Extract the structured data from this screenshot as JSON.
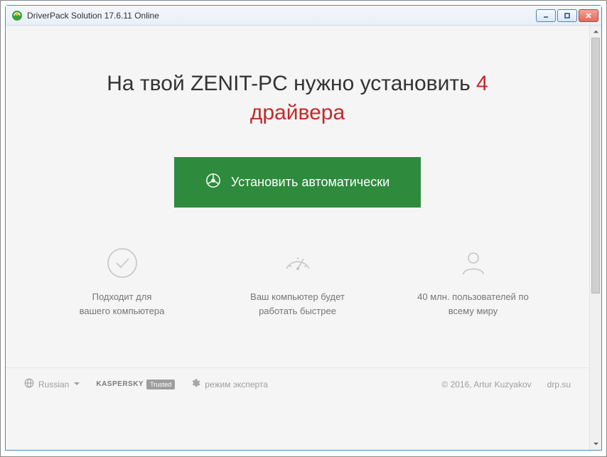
{
  "window": {
    "title": "DriverPack Solution 17.6.11 Online"
  },
  "headline": {
    "prefix": "На твой ",
    "pcname": "ZENIT-PC",
    "middle": " нужно установить ",
    "count": "4",
    "word": "драйвера"
  },
  "cta": {
    "label": "Установить автоматически"
  },
  "features": [
    {
      "icon": "check-circle-icon",
      "line1": "Подходит для",
      "line2": "вашего компьютера"
    },
    {
      "icon": "gauge-icon",
      "line1": "Ваш компьютер будет",
      "line2": "работать быстрее"
    },
    {
      "icon": "user-icon",
      "line1": "40 млн. пользователей по",
      "line2": "всему миру"
    }
  ],
  "footer": {
    "language": "Russian",
    "kaspersky_brand": "KASPERSKY",
    "kaspersky_badge": "Trusted",
    "expert_mode": "режим эксперта",
    "copyright": "© 2016, Artur Kuzyakov",
    "site": "drp.su"
  }
}
